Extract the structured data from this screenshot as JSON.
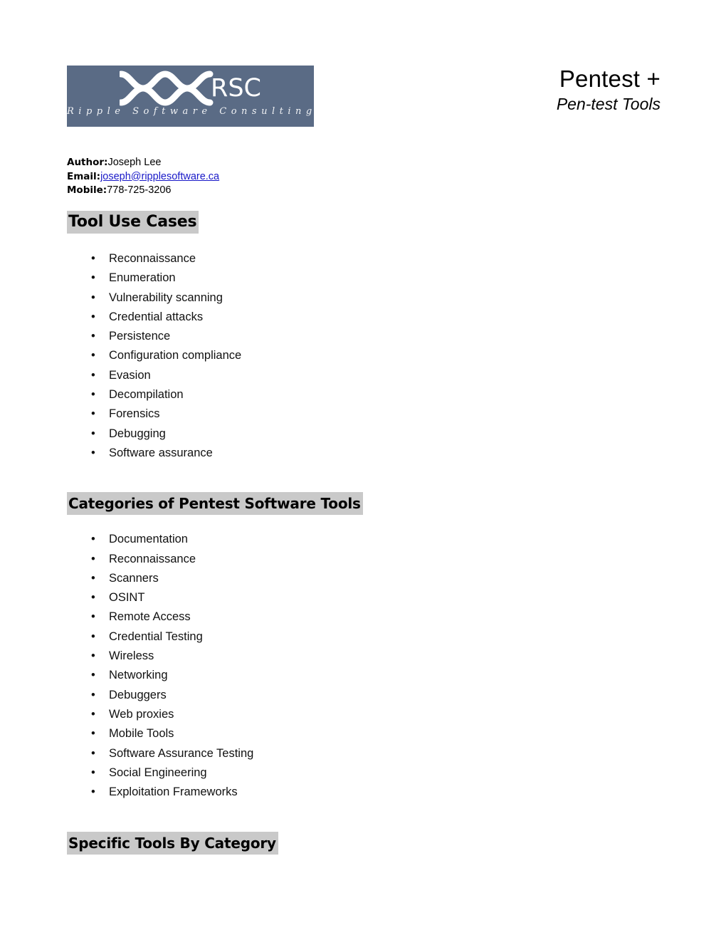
{
  "logo": {
    "mark_name": "ripple-dna-helix-mark",
    "wordmark": "RSC",
    "tagline": "Ripple Software Consulting",
    "background_color": "#5a6b85",
    "foreground_color": "#ffffff"
  },
  "header": {
    "title": "Pentest +",
    "subtitle": "Pen-test Tools"
  },
  "meta": {
    "author_label": "Author:",
    "author_value": "Joseph Lee",
    "email_label": "Email:",
    "email_value": "joseph@ripplesoftware.ca",
    "email_link_color": "#1818c8",
    "mobile_label": "Mobile:",
    "mobile_value": "778-725-3206"
  },
  "sections": {
    "highlight_color": "#c9c9c9",
    "tool_use_cases": {
      "heading": "Tool Use Cases",
      "items": [
        "Reconnaissance",
        "Enumeration",
        "Vulnerability scanning",
        "Credential attacks",
        "Persistence",
        "Configuration compliance",
        "Evasion",
        "Decompilation",
        "Forensics",
        "Debugging",
        "Software assurance"
      ]
    },
    "categories": {
      "heading": "Categories of Pentest Software Tools",
      "items": [
        "Documentation",
        "Reconnaissance",
        "Scanners",
        "OSINT",
        "Remote Access",
        "Credential Testing",
        "Wireless",
        "Networking",
        "Debuggers",
        "Web proxies",
        "Mobile Tools",
        "Software Assurance Testing",
        "Social Engineering",
        "Exploitation Frameworks"
      ]
    },
    "specific_tools": {
      "heading": "Specific Tools By Category"
    }
  },
  "bullet_glyph": "•"
}
